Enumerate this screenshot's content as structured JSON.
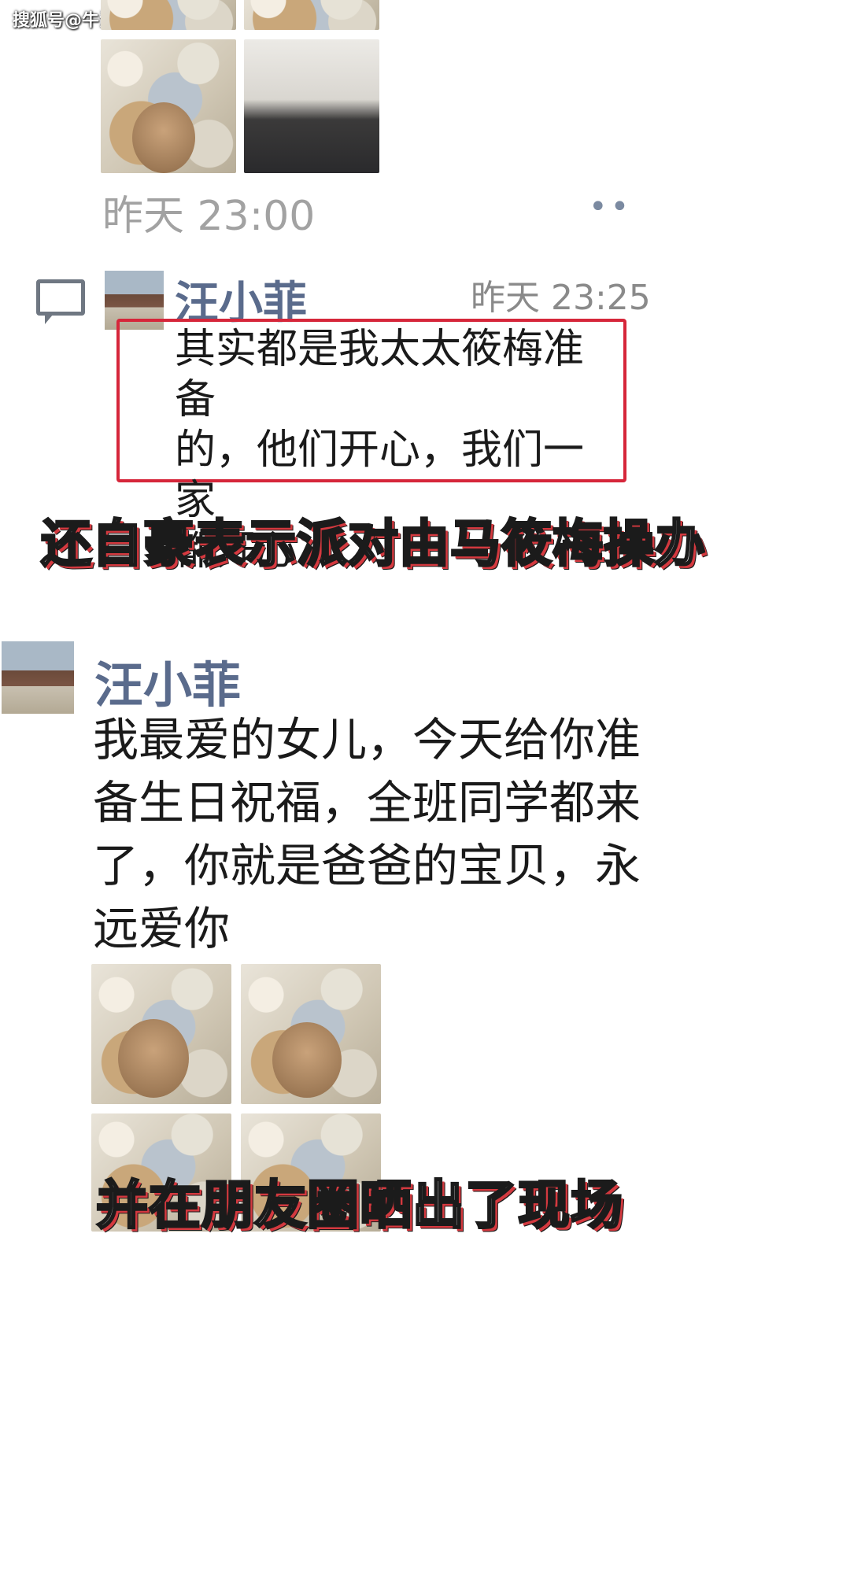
{
  "watermark": "搜狐号@牛油果的生活观",
  "post1": {
    "timestamp": "昨天 23:00",
    "more_icon": "more-dots-icon",
    "photos": [
      "photo",
      "photo",
      "photo",
      "photo"
    ]
  },
  "comment": {
    "icon": "comment-icon",
    "author": "汪小菲",
    "time": "昨天 23:25",
    "lines": [
      "其实都是我太太筱梅准备",
      "的，他们开心，我们一家",
      "都开心"
    ]
  },
  "caption1": "还自豪表示派对由马筱梅操办",
  "post2": {
    "author": "汪小菲",
    "lines": [
      "我最爱的女儿，今天给你准",
      "备生日祝福，全班同学都来",
      "了，你就是爸爸的宝贝，永",
      "远爱你"
    ]
  },
  "caption2": "并在朋友圈晒出了现场",
  "colors": {
    "name": "#5a6b8c",
    "highlight_border": "#d6263a",
    "caption_shadow": "#d4393f",
    "timestamp": "#a2a2a2"
  }
}
